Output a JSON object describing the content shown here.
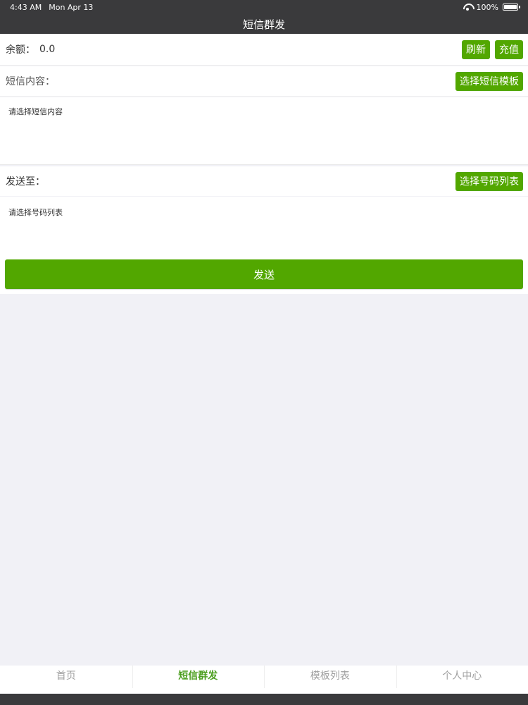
{
  "status": {
    "time": "4:43 AM",
    "date": "Mon Apr 13",
    "battery": "100%"
  },
  "nav": {
    "title": "短信群发"
  },
  "balance": {
    "label": "余额：",
    "value": "0.0",
    "refresh_label": "刷新",
    "recharge_label": "充值"
  },
  "content": {
    "label": "短信内容：",
    "select_template_label": "选择短信模板",
    "placeholder": "请选择短信内容"
  },
  "recipients": {
    "label": "发送至：",
    "select_numbers_label": "选择号码列表",
    "placeholder": "请选择号码列表"
  },
  "send": {
    "label": "发送"
  },
  "tabs": [
    {
      "label": "首页",
      "active": false
    },
    {
      "label": "短信群发",
      "active": true
    },
    {
      "label": "模板列表",
      "active": false
    },
    {
      "label": "个人中心",
      "active": false
    }
  ],
  "colors": {
    "accent": "#52a700",
    "bar": "#3a3a3c",
    "active_tab": "#4b9e1e",
    "inactive_tab": "#a0a0a0"
  }
}
